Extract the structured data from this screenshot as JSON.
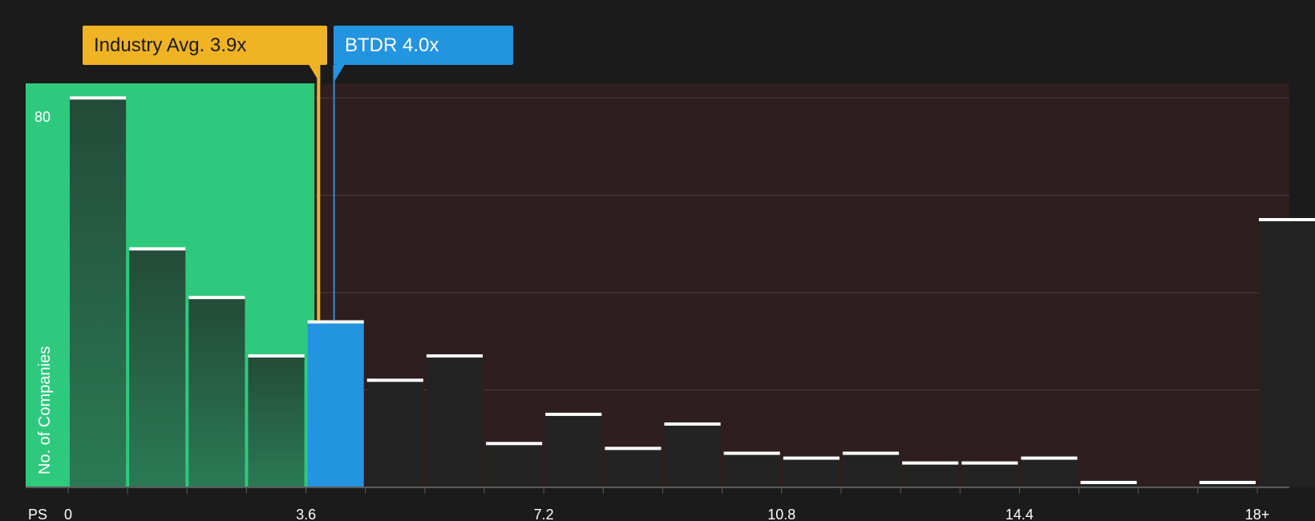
{
  "colors": {
    "background": "#1b1b1b",
    "below_region": "#2ec97d",
    "above_region": "#2f1e1f",
    "bar_dark": "#232323",
    "bar_green_top": "#234b38",
    "bar_highlight": "#2394e0",
    "industry_marker": "#f0b323",
    "company_marker": "#2394e0",
    "cap": "#ffffff",
    "grid": "#4a3d3e",
    "axis_text": "#ffffff"
  },
  "callouts": {
    "industry": "Industry Avg. 3.9x",
    "company": "BTDR 4.0x"
  },
  "chart_data": {
    "type": "bar",
    "xlabel": "PS",
    "ylabel": "No. of Companies",
    "x_ticks": [
      "0",
      "3.6",
      "7.2",
      "10.8",
      "14.4",
      "18+"
    ],
    "x_tick_values": [
      0,
      3.6,
      7.2,
      10.8,
      14.4,
      18
    ],
    "y_tick_labels": [
      "80"
    ],
    "y_tick_values": [
      80
    ],
    "ylim": [
      0,
      83
    ],
    "gridlines": [
      20,
      40,
      60,
      80
    ],
    "bin_width": 0.9,
    "industry_avg": 3.9,
    "company_value": 4.0,
    "company_bin_index": 4,
    "bins": [
      {
        "start": 0.0,
        "count": 80
      },
      {
        "start": 0.9,
        "count": 49
      },
      {
        "start": 1.8,
        "count": 39
      },
      {
        "start": 2.7,
        "count": 27
      },
      {
        "start": 3.6,
        "count": 34
      },
      {
        "start": 4.5,
        "count": 22
      },
      {
        "start": 5.4,
        "count": 27
      },
      {
        "start": 6.3,
        "count": 9
      },
      {
        "start": 7.2,
        "count": 15
      },
      {
        "start": 8.1,
        "count": 8
      },
      {
        "start": 9.0,
        "count": 13
      },
      {
        "start": 9.9,
        "count": 7
      },
      {
        "start": 10.8,
        "count": 6
      },
      {
        "start": 11.7,
        "count": 7
      },
      {
        "start": 12.6,
        "count": 5
      },
      {
        "start": 13.5,
        "count": 5
      },
      {
        "start": 14.4,
        "count": 6
      },
      {
        "start": 15.3,
        "count": 1
      },
      {
        "start": 16.2,
        "count": 0
      },
      {
        "start": 17.1,
        "count": 1
      },
      {
        "start": 18.0,
        "count": 55
      }
    ]
  }
}
